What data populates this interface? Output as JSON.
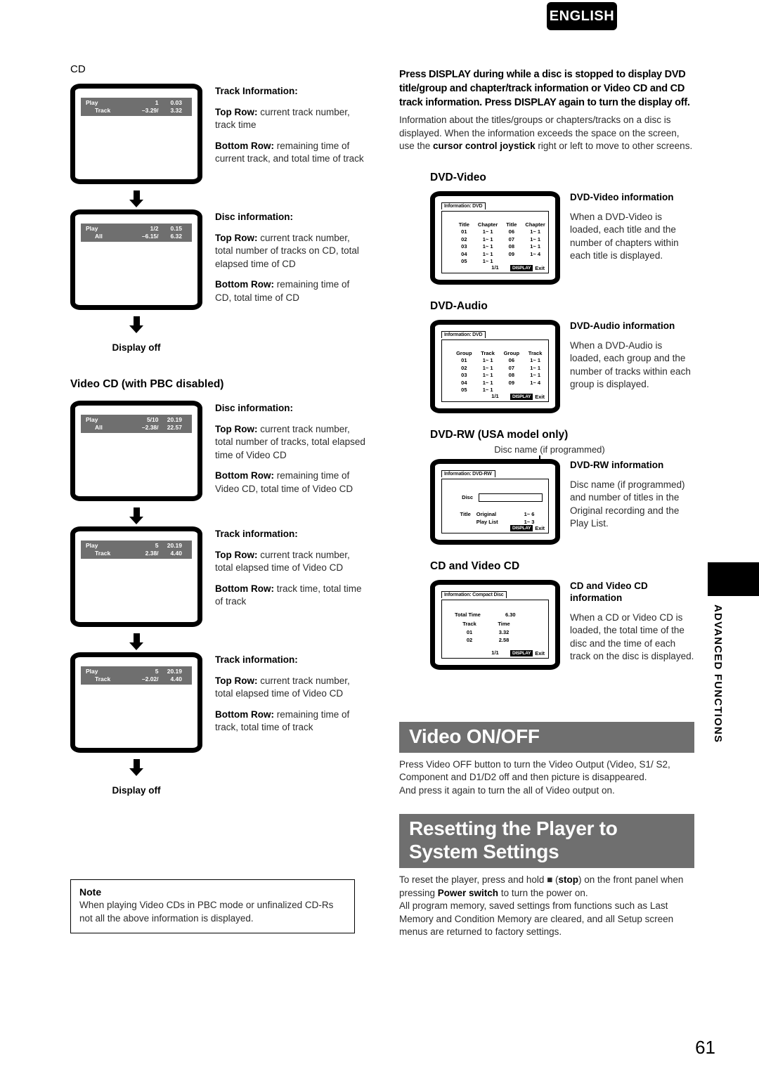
{
  "header": {
    "language_badge": "ENGLISH"
  },
  "side_tab": {
    "label": "ADVANCED FUNCTIONS"
  },
  "footer": {
    "page_number": "61"
  },
  "left_column": {
    "cd_heading": "CD",
    "cd_flow": [
      {
        "osd": {
          "row1": {
            "mode": "Play",
            "c2": "1",
            "c3": "0.03"
          },
          "row2": {
            "mode": "Track",
            "c2": "–3.29/",
            "c3": "3.32"
          }
        },
        "title": "Track Information:",
        "paragraphs": [
          {
            "label": "Top Row:",
            "text": " current track number, track time"
          },
          {
            "label": "Bottom Row:",
            "text": " remaining time of current track, and total time of track"
          }
        ]
      },
      {
        "osd": {
          "row1": {
            "mode": "Play",
            "c2": "1/2",
            "c3": "0.15"
          },
          "row2": {
            "mode": "All",
            "c2": "–6.15/",
            "c3": "6.32"
          }
        },
        "title": "Disc information:",
        "paragraphs": [
          {
            "label": "Top Row:",
            "text": " current track number, total number of tracks on CD, total elapsed time of CD"
          },
          {
            "label": "Bottom Row:",
            "text": " remaining time of CD, total time of CD"
          }
        ]
      }
    ],
    "cd_display_off": "Display off",
    "vcd_heading": "Video CD (with PBC disabled)",
    "vcd_flow": [
      {
        "osd": {
          "row1": {
            "mode": "Play",
            "c2": "5/10",
            "c3": "20.19"
          },
          "row2": {
            "mode": "All",
            "c2": "–2.38/",
            "c3": "22.57"
          }
        },
        "title": "Disc information:",
        "paragraphs": [
          {
            "label": "Top Row:",
            "text": " current track number, total number of tracks, total elapsed time of Video CD"
          },
          {
            "label": "Bottom Row:",
            "text": " remaining time of Video CD, total time of Video CD"
          }
        ]
      },
      {
        "osd": {
          "row1": {
            "mode": "Play",
            "c2": "5",
            "c3": "20.19"
          },
          "row2": {
            "mode": "Track",
            "c2": "2.38/",
            "c3": "4.40"
          }
        },
        "title": "Track information:",
        "paragraphs": [
          {
            "label": "Top Row:",
            "text": " current track number, total elapsed time of Video CD"
          },
          {
            "label": "Bottom Row:",
            "text": " track time, total time of track"
          }
        ]
      },
      {
        "osd": {
          "row1": {
            "mode": "Play",
            "c2": "5",
            "c3": "20.19"
          },
          "row2": {
            "mode": "Track",
            "c2": "–2.02/",
            "c3": "4.40"
          }
        },
        "title": "Track information:",
        "paragraphs": [
          {
            "label": "Top Row:",
            "text": " current track number, total elapsed time of Video CD"
          },
          {
            "label": "Bottom Row:",
            "text": " remaining time of track, total time of track"
          }
        ]
      }
    ],
    "vcd_display_off": "Display off",
    "note": {
      "title": "Note",
      "body": "When playing Video CDs in PBC mode or unfinalized CD-Rs not all the above information is displayed."
    }
  },
  "right_column": {
    "intro_bold": "Press DISPLAY during while a disc is stopped to display DVD title/group and chapter/track information or Video CD and CD track information. Press DISPLAY again to turn the display off.",
    "intro_body_1": "Information about the titles/groups or chapters/tracks on a disc is displayed. When the information exceeds the space on the screen, use the ",
    "intro_body_bold": "cursor control joystick",
    "intro_body_2": " right or left to move to other screens.",
    "dvd_video": {
      "heading": "DVD-Video",
      "screen": {
        "tab": "Information: DVD",
        "headers": [
          "Title",
          "Chapter",
          "Title",
          "Chapter"
        ],
        "rows": [
          [
            "01",
            "1~ 1",
            "06",
            "1~ 1"
          ],
          [
            "02",
            "1~ 1",
            "07",
            "1~ 1"
          ],
          [
            "03",
            "1~ 1",
            "08",
            "1~ 1"
          ],
          [
            "04",
            "1~ 1",
            "09",
            "1~ 4"
          ],
          [
            "05",
            "1~ 1",
            "",
            ""
          ]
        ],
        "page": "1/1",
        "display_chip": "DISPLAY",
        "exit_label": "Exit"
      },
      "info_title": "DVD-Video information",
      "info_body": "When a DVD-Video is loaded, each title and the number of chapters within each title is displayed."
    },
    "dvd_audio": {
      "heading": "DVD-Audio",
      "screen": {
        "tab": "Information: DVD",
        "headers": [
          "Group",
          "Track",
          "Group",
          "Track"
        ],
        "rows": [
          [
            "01",
            "1~ 1",
            "06",
            "1~ 1"
          ],
          [
            "02",
            "1~ 1",
            "07",
            "1~ 1"
          ],
          [
            "03",
            "1~ 1",
            "08",
            "1~ 1"
          ],
          [
            "04",
            "1~ 1",
            "09",
            "1~ 4"
          ],
          [
            "05",
            "1~ 1",
            "",
            ""
          ]
        ],
        "page": "1/1",
        "display_chip": "DISPLAY",
        "exit_label": "Exit"
      },
      "info_title": "DVD-Audio information",
      "info_body": "When a DVD-Audio is loaded, each group and the number of tracks within each group is displayed."
    },
    "dvd_rw": {
      "heading": "DVD-RW (USA model only)",
      "callout": "Disc name (if programmed)",
      "screen": {
        "tab": "Information: DVD-RW",
        "disc_label": "Disc",
        "title_label": "Title",
        "rows": [
          {
            "name": "Original",
            "value": "1~ 6"
          },
          {
            "name": "Play List",
            "value": "1~ 3"
          }
        ],
        "display_chip": "DISPLAY",
        "exit_label": "Exit"
      },
      "info_title": "DVD-RW information",
      "info_body": "Disc name (if programmed) and number of titles in the Original recording and the Play List."
    },
    "cd_vcd": {
      "heading": "CD and Video CD",
      "screen": {
        "tab": "Information: Compact Disc",
        "total_time_label": "Total Time",
        "total_time_value": "6.30",
        "headers": [
          "Track",
          "Time"
        ],
        "rows": [
          [
            "01",
            "3.32"
          ],
          [
            "02",
            "2.58"
          ]
        ],
        "page": "1/1",
        "display_chip": "DISPLAY",
        "exit_label": "Exit"
      },
      "info_title": "CD and Video CD information",
      "info_body": "When a CD or Video CD is loaded, the total time of the disc and the time of each track on the disc  is displayed."
    },
    "video_onoff": {
      "banner": "Video ON/OFF",
      "body": "Press Video OFF button to turn the Video Output (Video, S1/ S2, Component and D1/D2 off and then picture is disappeared.\nAnd press it again to turn the all of Video output on."
    },
    "resetting": {
      "banner_line1": "Resetting the Player to",
      "banner_line2": "System Settings",
      "body_1": "To reset the player, press and hold ■ (",
      "body_stop": "stop",
      "body_2": ") on the front panel when pressing ",
      "body_power": "Power switch",
      "body_3": " to turn the power on.",
      "body_4": "All program memory, saved settings from functions such as Last Memory and Condition Memory are cleared, and all Setup screen menus are returned to factory settings."
    }
  }
}
